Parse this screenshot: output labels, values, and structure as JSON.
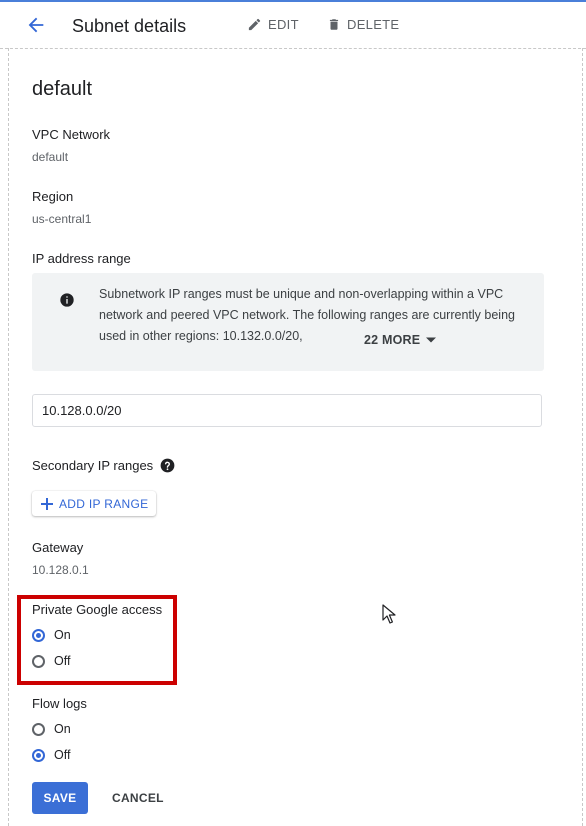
{
  "header": {
    "title": "Subnet details",
    "edit_label": "EDIT",
    "delete_label": "DELETE"
  },
  "subnet": {
    "name": "default",
    "vpc_label": "VPC Network",
    "vpc_value": "default",
    "region_label": "Region",
    "region_value": "us-central1",
    "ip_range_label": "IP address range",
    "info_text": "Subnetwork IP ranges must be unique and non-overlapping within a VPC network and peered VPC network. The following ranges are currently being used in other regions: 10.132.0.0/20,",
    "more_label": "22 MORE",
    "ip_range_value": "10.128.0.0/20",
    "secondary_label": "Secondary IP ranges",
    "add_range_label": "ADD IP RANGE",
    "gateway_label": "Gateway",
    "gateway_value": "10.128.0.1"
  },
  "private_google_access": {
    "label": "Private Google access",
    "options": [
      "On",
      "Off"
    ],
    "selected": "On"
  },
  "flow_logs": {
    "label": "Flow logs",
    "options": [
      "On",
      "Off"
    ],
    "selected": "Off"
  },
  "actions": {
    "save_label": "SAVE",
    "cancel_label": "CANCEL"
  },
  "colors": {
    "accent": "#3367d6",
    "highlight": "#cc0000",
    "info_bg": "#f1f3f4"
  }
}
